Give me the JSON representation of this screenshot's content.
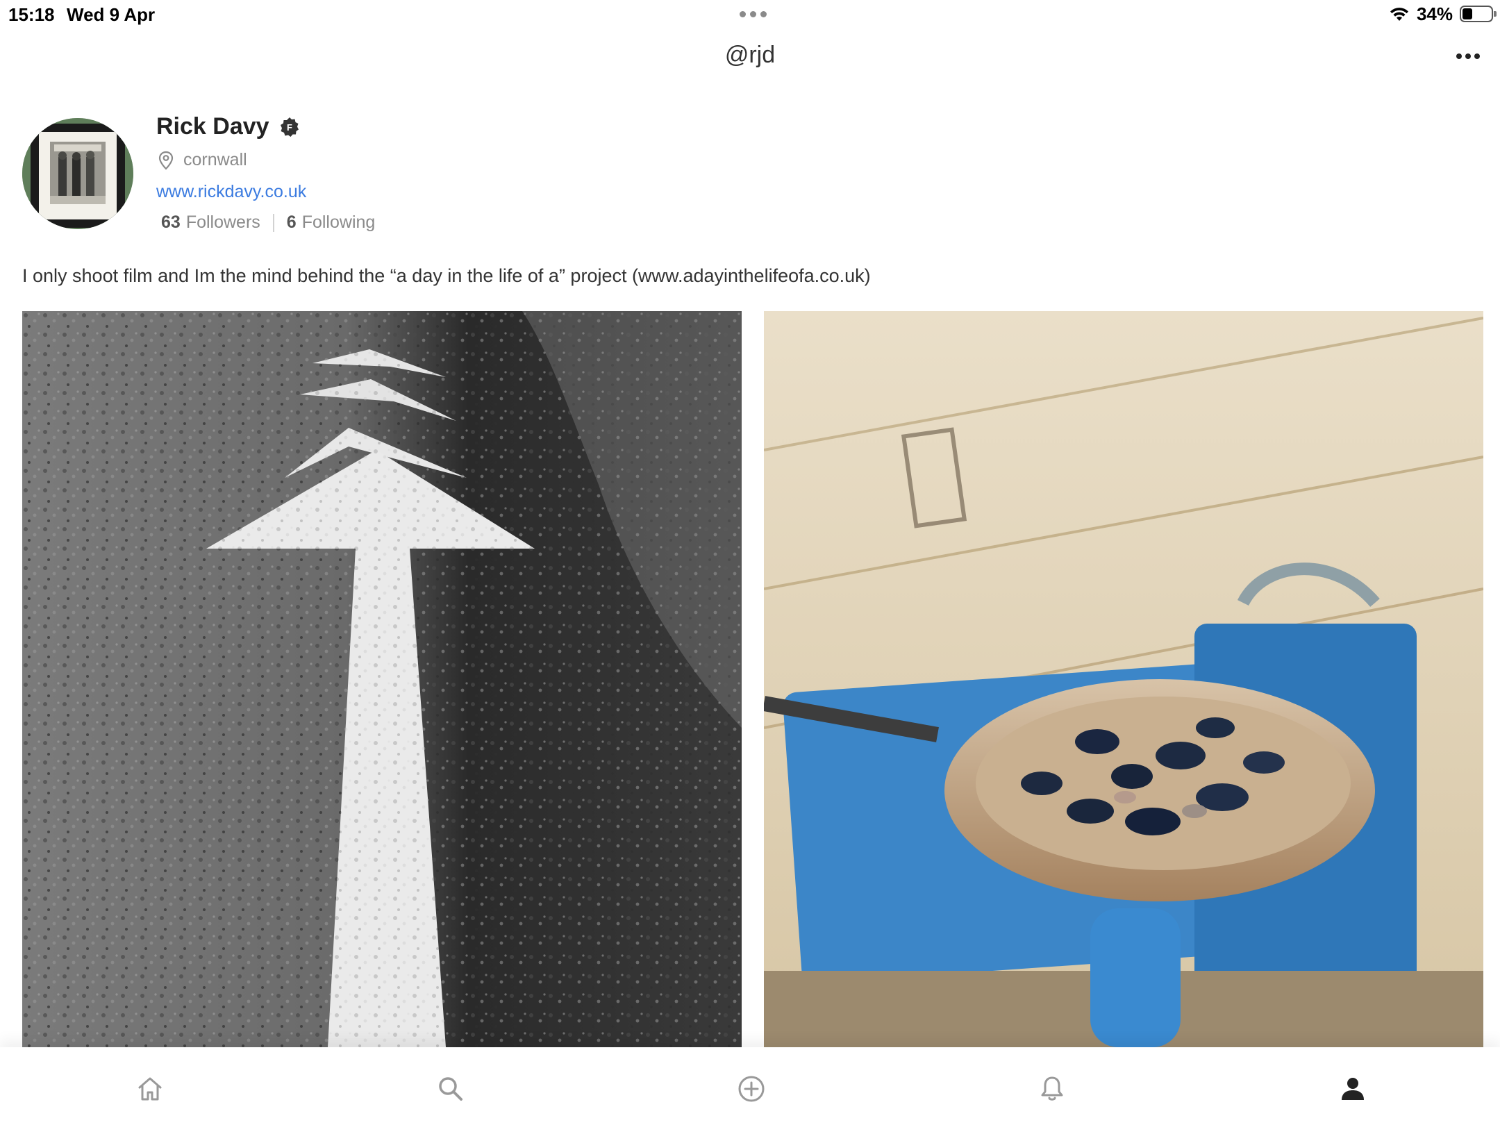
{
  "status_bar": {
    "time": "15:18",
    "date": "Wed 9 Apr",
    "battery_percent": "34%",
    "battery_level": 0.34,
    "icons": [
      "wifi-icon",
      "battery-icon"
    ]
  },
  "header": {
    "handle": "@rjd",
    "more_icon": "more-horizontal-icon"
  },
  "profile": {
    "name": "Rick Davy",
    "badge_letter": "F",
    "location": "cornwall",
    "website": "www.rickdavy.co.uk",
    "followers_count": "63",
    "followers_label": "Followers",
    "following_count": "6",
    "following_label": "Following",
    "bio": "I only shoot film and Im the mind behind the “a day in the life of a” project (www.adayinthelifeofa.co.uk)"
  },
  "photos": [
    {
      "subject": "road-arrow-bw"
    },
    {
      "subject": "mussels-pan-stove"
    }
  ],
  "tab_bar": {
    "tabs": [
      {
        "icon": "home-icon"
      },
      {
        "icon": "search-icon"
      },
      {
        "icon": "add-circle-icon"
      },
      {
        "icon": "bell-icon"
      },
      {
        "icon": "profile-icon",
        "active": true
      }
    ],
    "active_color": "#222222",
    "inactive_color": "#999999"
  },
  "colors": {
    "link": "#3b7be0",
    "muted_text": "#8a8a8a"
  }
}
